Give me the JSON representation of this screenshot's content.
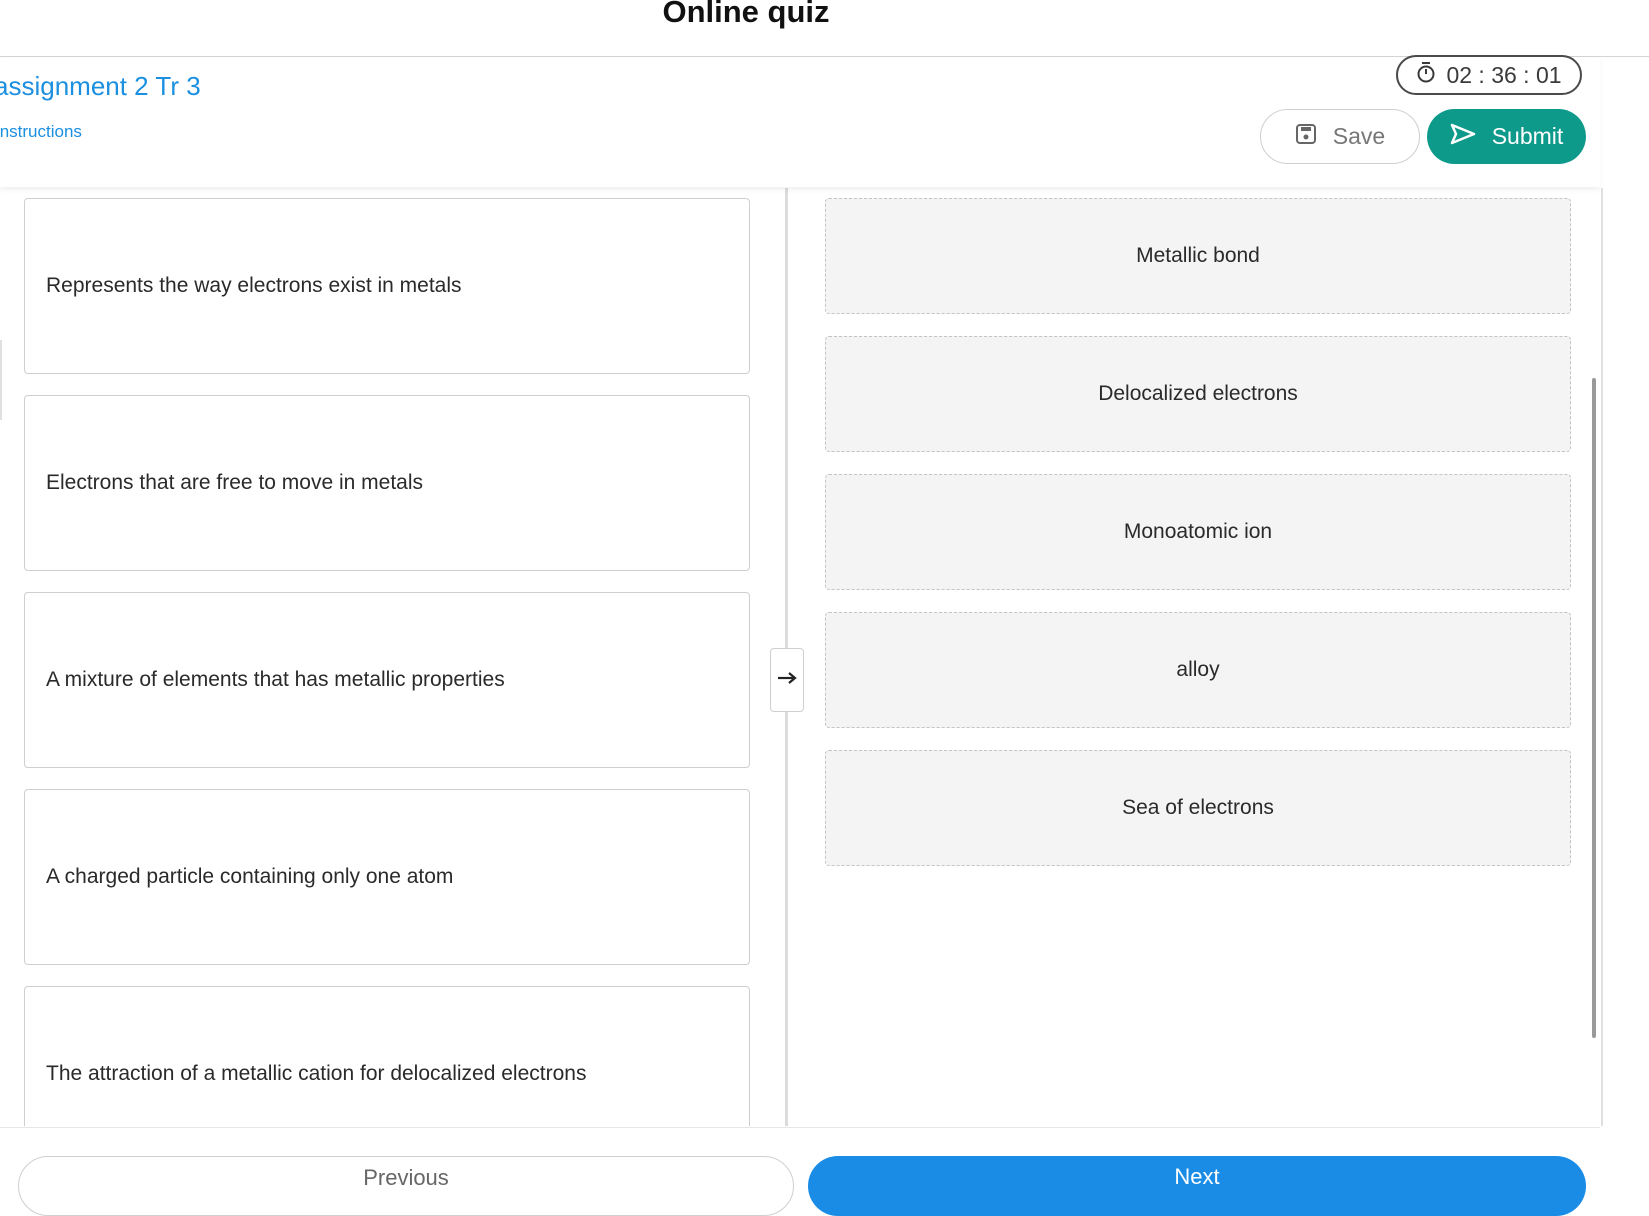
{
  "app": {
    "title": "Online quiz"
  },
  "header": {
    "assignment_title": "assignment 2 Tr 3",
    "instructions_link": "Instructions",
    "timer": "02 : 36 : 01",
    "save_label": "Save",
    "submit_label": "Submit"
  },
  "matching": {
    "prompts": [
      "Represents the way electrons exist in metals",
      "Electrons that are free to move in metals",
      "A mixture of elements that has metallic properties",
      "A charged particle containing only one atom",
      "The attraction of a metallic cation for delocalized electrons"
    ],
    "answers": [
      "Metallic bond",
      "Delocalized electrons",
      "Monoatomic ion",
      "alloy",
      "Sea of electrons"
    ]
  },
  "footer": {
    "prev_label": "Previous",
    "next_label": "Next"
  },
  "icons": {
    "timer": "stopwatch-icon",
    "save": "floppy-disk-icon",
    "submit": "send-icon",
    "handle": "arrow-right-icon"
  },
  "colors": {
    "accent_blue": "#1b8fe0",
    "submit_teal": "#0e9a8a",
    "next_blue": "#1a8ce6"
  }
}
